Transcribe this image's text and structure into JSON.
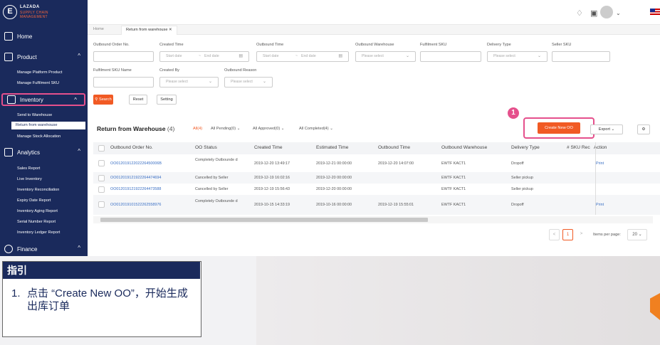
{
  "logo": {
    "mark": "E",
    "line1": "LAZADA",
    "line2": "SUPPLY CHAIN",
    "line3": "MANAGEMENT"
  },
  "sidebar": {
    "home": "Home",
    "product": "Product",
    "product_items": [
      "Manage Platform Product",
      "Manage Fulfilment SKU"
    ],
    "inventory": "Inventory",
    "inventory_items": [
      "Send to Warehouse",
      "Return from warehouse",
      "Manage Stock Allocation"
    ],
    "analytics": "Analytics",
    "analytics_items": [
      "Sales Report",
      "Live Inventory",
      "Inventory Reconciliation",
      "Expiry Date Report",
      "Inventory Aging Report",
      "Serial Number Report",
      "Inventory Ledger Report"
    ],
    "finance": "Finance"
  },
  "tabs": {
    "home": "Home",
    "active": "Return from warehouse"
  },
  "filters": {
    "outbound_order_no": "Outbound Order No.",
    "created_time": "Created Time",
    "outbound_time": "Outbound Time",
    "outbound_warehouse": "Outbound Warehouse",
    "fulfilment_sku": "Fulfilment SKU",
    "delivery_type": "Delivery Type",
    "seller_sku": "Seller SKU",
    "fulfilment_sku_name": "Fulfilment SKU Name",
    "created_by": "Created By",
    "outbound_reason": "Outbound Reason",
    "start_date": "Start date",
    "end_date": "End date",
    "please_select": "Please select",
    "date_sep": "~"
  },
  "buttons": {
    "search": "Search",
    "reset": "Reset",
    "setting": "Setting",
    "create": "Create New OO",
    "export": "Export"
  },
  "section": {
    "title": "Return from Warehouse",
    "count": "(4)",
    "tabs": [
      "All(4)",
      "All Pending(0)",
      "All Approved(0)",
      "All Completed(4)"
    ]
  },
  "step": "1",
  "table": {
    "headers": [
      "Outbound Order No.",
      "OO Status",
      "Created Time",
      "Estimated Time",
      "Outbound Time",
      "Outbound Warehouse",
      "Delivery Type",
      "# SKU Rec",
      "Action"
    ],
    "rows": [
      [
        "OO01201912202226450006B",
        "Completely Outbounde d",
        "2019-12-20 13:49:17",
        "2019-12-21 00:00:00",
        "2019-12-20 14:07:00",
        "EWTF KACT1",
        "Dropoff",
        "",
        "Print"
      ],
      [
        "OO01201912192226447469­4",
        "Cancelled by Seller",
        "2019-12-19 16:02:16",
        "2019-12-20 00:00:00",
        "",
        "EWTF KACT1",
        "Seller pickup",
        "",
        ""
      ],
      [
        "OO012019121922264473588",
        "Cancelled by Seller",
        "2019-12-19 15:56:43",
        "2019-12-20 00:00:00",
        "",
        "EWTF KACT1",
        "Seller pickup",
        "",
        ""
      ],
      [
        "OO012019101522262558976",
        "Completely Outbounde d",
        "2019-10-15 14:33:19",
        "2019-10-16 00:00:00",
        "2019-12-19 15:55:01",
        "EWTF KACT1",
        "Dropoff",
        "",
        "Print"
      ]
    ]
  },
  "pagination": {
    "page": "1",
    "items_label": "Items per page:",
    "per_page": "20"
  },
  "guide": {
    "title": "指引",
    "num": "1.",
    "text": "点击 “Create New OO”，开始生成出库订单"
  },
  "colors": {
    "brand": "#1a2a5c",
    "accent": "#f15a24",
    "highlight": "#e5508c"
  }
}
